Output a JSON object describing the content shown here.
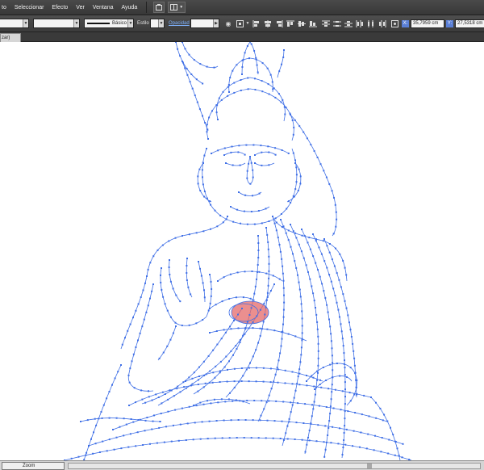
{
  "menubar": {
    "items": [
      "to",
      "Seleccionar",
      "Efecto",
      "Ver",
      "Ventana",
      "Ayuda"
    ]
  },
  "controlbar": {
    "stroke_profile": "Básico",
    "style_label": "Estilo",
    "opacity_label": "Opacidad",
    "x_label": "X:",
    "x_value": "35,7959 cm",
    "y_label": "Y:",
    "y_value": "27,5318 cm"
  },
  "document": {
    "tab_label": "zar)"
  },
  "statusbar": {
    "zoom_label": "Zoom"
  },
  "colors": {
    "path_blue": "#3f6fe6",
    "selection_fill": "#e46a6a"
  }
}
